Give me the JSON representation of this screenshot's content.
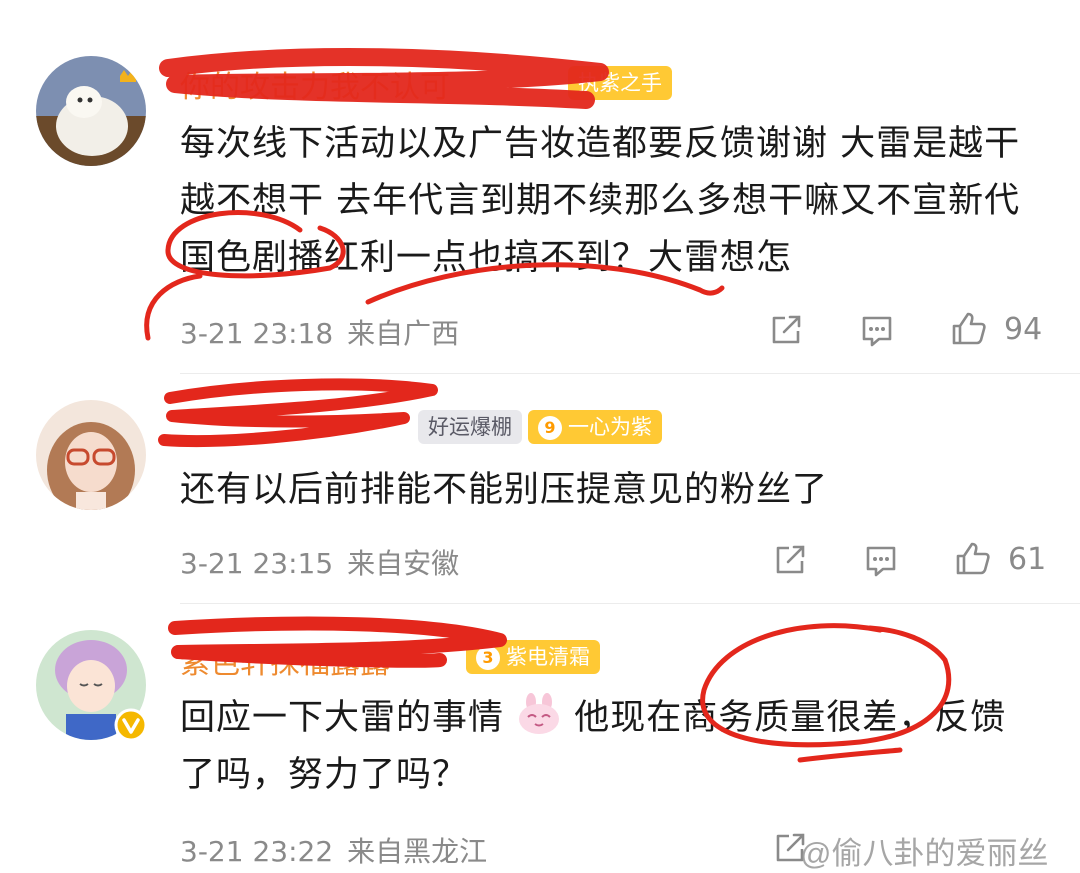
{
  "comments": [
    {
      "username": "你的攻击力我不认可",
      "badges": [
        {
          "label": "执紫之手",
          "level": ""
        }
      ],
      "text": "每次线下活动以及广告妆造都要反馈谢谢 大雷是越干越不想干 去年代言到期不续那么多想干嘛又不宣新代 国色剧播红利一点也搞不到？大雷想怎",
      "time": "3-21 23:18",
      "location": "来自广西",
      "likes": "94"
    },
    {
      "username": "",
      "badges": [
        {
          "label": "好运爆棚",
          "level": ""
        },
        {
          "label": "一心为紫",
          "level": "9"
        }
      ],
      "text": "还有以后前排能不能别压提意见的粉丝了",
      "time": "3-21 23:15",
      "location": "来自安徽",
      "likes": "61"
    },
    {
      "username": "紫色轩探福露露",
      "badges": [
        {
          "label": "紫电清霜",
          "level": "3"
        }
      ],
      "text_a": "回应一下大雷的事情",
      "text_b": "他现在商务质量很差，反馈了吗，努力了吗？",
      "time": "3-21 23:22",
      "location": "来自黑龙江",
      "likes": ""
    }
  ],
  "icons": [
    "share-icon",
    "comment-icon",
    "like-icon",
    "smiling-rabbit-emoji",
    "verified-v-icon"
  ],
  "watermark": "@偷八卦的爱丽丝",
  "colors": {
    "scribble": "#e3271c",
    "badge": "#ffc934",
    "verified": "#f5b800"
  }
}
